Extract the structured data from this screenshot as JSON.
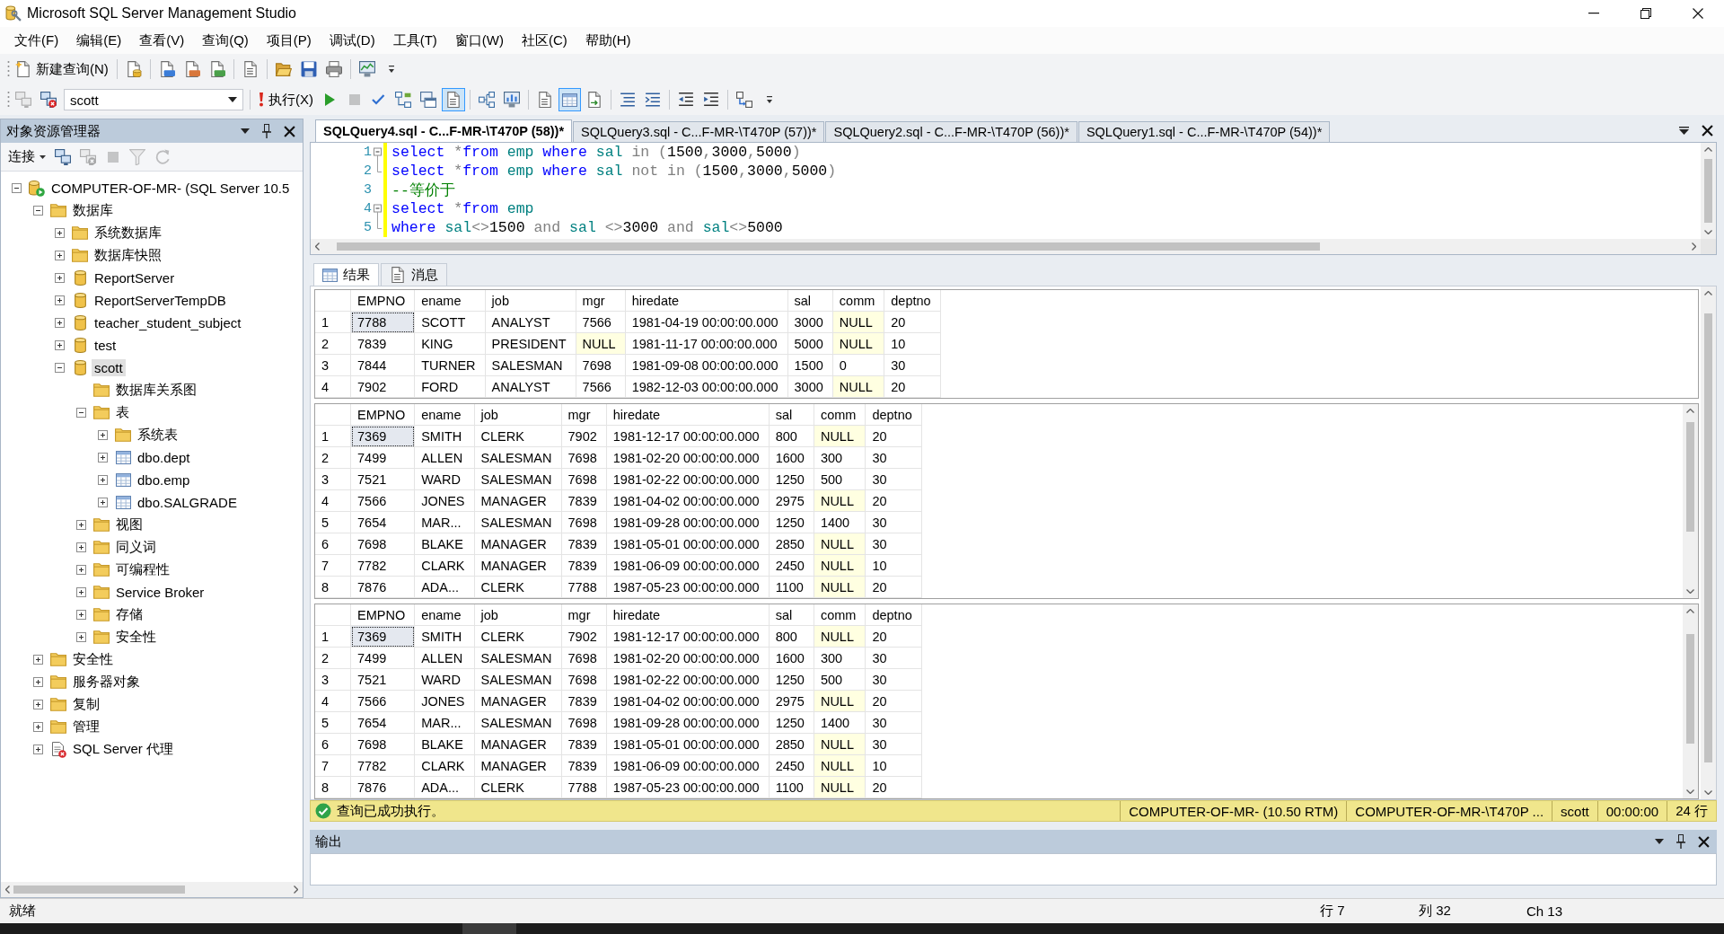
{
  "window": {
    "title": "Microsoft SQL Server Management Studio"
  },
  "menu": [
    "文件(F)",
    "编辑(E)",
    "查看(V)",
    "查询(Q)",
    "项目(P)",
    "调试(D)",
    "工具(T)",
    "窗口(W)",
    "社区(C)",
    "帮助(H)"
  ],
  "toolbar_1": [
    {
      "kind": "new_query",
      "label": "新建查询(N)"
    },
    {
      "kind": "separator"
    },
    {
      "kind": "database_query"
    },
    {
      "kind": "separator"
    },
    {
      "kind": "mdx_query"
    },
    {
      "kind": "dmx_query"
    },
    {
      "kind": "xmla_query"
    },
    {
      "kind": "separator"
    },
    {
      "kind": "compact_query"
    },
    {
      "kind": "separator"
    },
    {
      "kind": "open"
    },
    {
      "kind": "save"
    },
    {
      "kind": "print"
    },
    {
      "kind": "separator"
    },
    {
      "kind": "activity_monitor"
    },
    {
      "kind": "overflow"
    }
  ],
  "toolbar_2": [
    {
      "kind": "connect",
      "disabled": true,
      "pressed": false
    },
    {
      "kind": "change_connection",
      "disabled": false,
      "pressed": false
    },
    {
      "kind": "database",
      "value": "scott"
    },
    {
      "kind": "separator"
    },
    {
      "kind": "execute",
      "label": "执行(X)",
      "disabled": false,
      "pressed": false
    },
    {
      "kind": "debug",
      "disabled": false,
      "pressed": false
    },
    {
      "kind": "cancel",
      "disabled": true,
      "pressed": false
    },
    {
      "kind": "parse",
      "disabled": false,
      "pressed": false
    },
    {
      "kind": "estimated_plan",
      "disabled": false,
      "pressed": false
    },
    {
      "kind": "query_options",
      "disabled": false,
      "pressed": false
    },
    {
      "kind": "intellisense",
      "disabled": false,
      "pressed": true
    },
    {
      "kind": "separator"
    },
    {
      "kind": "include_plan",
      "disabled": false,
      "pressed": false
    },
    {
      "kind": "client_statistics",
      "disabled": false,
      "pressed": false
    },
    {
      "kind": "separator"
    },
    {
      "kind": "results_text",
      "disabled": false,
      "pressed": false
    },
    {
      "kind": "results_grid",
      "disabled": false,
      "pressed": true
    },
    {
      "kind": "results_file",
      "disabled": false,
      "pressed": false
    },
    {
      "kind": "separator"
    },
    {
      "kind": "comment",
      "disabled": false,
      "pressed": false
    },
    {
      "kind": "uncomment",
      "disabled": false,
      "pressed": false
    },
    {
      "kind": "separator"
    },
    {
      "kind": "decrease_indent",
      "disabled": false,
      "pressed": false
    },
    {
      "kind": "increase_indent",
      "disabled": false,
      "pressed": false
    },
    {
      "kind": "separator"
    },
    {
      "kind": "template_values",
      "disabled": false,
      "pressed": false
    },
    {
      "kind": "overflow",
      "disabled": false,
      "pressed": false
    }
  ],
  "object_explorer": {
    "title": "对象资源管理器",
    "toolbar": [
      {
        "kind": "connect_menu",
        "label": "连接",
        "disabled": false
      },
      {
        "kind": "connect",
        "disabled": false
      },
      {
        "kind": "disconnect",
        "disabled": true
      },
      {
        "kind": "stop",
        "disabled": true
      },
      {
        "kind": "filter",
        "disabled": true
      },
      {
        "kind": "refresh",
        "disabled": true
      }
    ],
    "tree": [
      {
        "label": "COMPUTER-OF-MR- (SQL Server 10.5",
        "kind": "server",
        "expanded": true,
        "selected": false,
        "children": [
          {
            "label": "数据库",
            "kind": "folder",
            "expanded": true,
            "selected": false,
            "children": [
              {
                "label": "系统数据库",
                "kind": "folder",
                "expanded": false,
                "selected": false
              },
              {
                "label": "数据库快照",
                "kind": "folder",
                "expanded": false,
                "selected": false
              },
              {
                "label": "ReportServer",
                "kind": "database",
                "expanded": false,
                "selected": false
              },
              {
                "label": "ReportServerTempDB",
                "kind": "database",
                "expanded": false,
                "selected": false
              },
              {
                "label": "teacher_student_subject",
                "kind": "database",
                "expanded": false,
                "selected": false
              },
              {
                "label": "test",
                "kind": "database",
                "expanded": false,
                "selected": false
              },
              {
                "label": "scott",
                "kind": "database",
                "expanded": true,
                "selected": true,
                "children": [
                  {
                    "label": "数据库关系图",
                    "kind": "folder",
                    "selected": false
                  },
                  {
                    "label": "表",
                    "kind": "folder",
                    "expanded": true,
                    "selected": false,
                    "children": [
                      {
                        "label": "系统表",
                        "kind": "folder",
                        "expanded": false,
                        "selected": false
                      },
                      {
                        "label": "dbo.dept",
                        "kind": "table",
                        "expanded": false,
                        "selected": false
                      },
                      {
                        "label": "dbo.emp",
                        "kind": "table",
                        "expanded": false,
                        "selected": false
                      },
                      {
                        "label": "dbo.SALGRADE",
                        "kind": "table",
                        "expanded": false,
                        "selected": false
                      }
                    ]
                  },
                  {
                    "label": "视图",
                    "kind": "folder",
                    "expanded": false,
                    "selected": false
                  },
                  {
                    "label": "同义词",
                    "kind": "folder",
                    "expanded": false,
                    "selected": false
                  },
                  {
                    "label": "可编程性",
                    "kind": "folder",
                    "expanded": false,
                    "selected": false
                  },
                  {
                    "label": "Service Broker",
                    "kind": "folder",
                    "expanded": false,
                    "selected": false
                  },
                  {
                    "label": "存储",
                    "kind": "folder",
                    "expanded": false,
                    "selected": false
                  },
                  {
                    "label": "安全性",
                    "kind": "folder",
                    "expanded": false,
                    "selected": false
                  }
                ]
              }
            ]
          },
          {
            "label": "安全性",
            "kind": "folder",
            "expanded": false,
            "selected": false
          },
          {
            "label": "服务器对象",
            "kind": "folder",
            "expanded": false,
            "selected": false
          },
          {
            "label": "复制",
            "kind": "folder",
            "expanded": false,
            "selected": false
          },
          {
            "label": "管理",
            "kind": "folder",
            "expanded": false,
            "selected": false
          },
          {
            "label": "SQL Server 代理",
            "kind": "agent",
            "expanded": false,
            "selected": false
          }
        ]
      }
    ]
  },
  "documents": {
    "tabs": [
      {
        "label": "SQLQuery4.sql - C...F-MR-\\T470P (58))*",
        "selected": true
      },
      {
        "label": "SQLQuery3.sql - C...F-MR-\\T470P (57))*",
        "selected": false
      },
      {
        "label": "SQLQuery2.sql - C...F-MR-\\T470P (56))*",
        "selected": false
      },
      {
        "label": "SQLQuery1.sql - C...F-MR-\\T470P (54))*",
        "selected": false
      }
    ]
  },
  "editor": {
    "lines": [
      {
        "number": "1",
        "kind": "start",
        "changed": true,
        "tokens": [
          {
            "kind": "keyword",
            "text": "select "
          },
          {
            "kind": "operator",
            "text": "*"
          },
          {
            "kind": "keyword",
            "text": "from "
          },
          {
            "kind": "identifier",
            "text": "emp "
          },
          {
            "kind": "keyword",
            "text": "where "
          },
          {
            "kind": "identifier",
            "text": "sal "
          },
          {
            "kind": "operator",
            "text": "in ("
          },
          {
            "kind": "plain",
            "text": "1500"
          },
          {
            "kind": "operator",
            "text": ","
          },
          {
            "kind": "plain",
            "text": "3000"
          },
          {
            "kind": "operator",
            "text": ","
          },
          {
            "kind": "plain",
            "text": "5000"
          },
          {
            "kind": "operator",
            "text": ")"
          }
        ]
      },
      {
        "number": "2",
        "kind": "end",
        "changed": true,
        "tokens": [
          {
            "kind": "keyword",
            "text": "select "
          },
          {
            "kind": "operator",
            "text": "*"
          },
          {
            "kind": "keyword",
            "text": "from "
          },
          {
            "kind": "identifier",
            "text": "emp "
          },
          {
            "kind": "keyword",
            "text": "where "
          },
          {
            "kind": "identifier",
            "text": "sal "
          },
          {
            "kind": "operator",
            "text": "not in ("
          },
          {
            "kind": "plain",
            "text": "1500"
          },
          {
            "kind": "operator",
            "text": ","
          },
          {
            "kind": "plain",
            "text": "3000"
          },
          {
            "kind": "operator",
            "text": ","
          },
          {
            "kind": "plain",
            "text": "5000"
          },
          {
            "kind": "operator",
            "text": ")"
          }
        ]
      },
      {
        "number": "3",
        "kind": "plain",
        "changed": true,
        "tokens": [
          {
            "kind": "comment",
            "text": "--等价于"
          }
        ]
      },
      {
        "number": "4",
        "kind": "start",
        "changed": true,
        "tokens": [
          {
            "kind": "keyword",
            "text": "select "
          },
          {
            "kind": "operator",
            "text": "*"
          },
          {
            "kind": "keyword",
            "text": "from "
          },
          {
            "kind": "identifier",
            "text": "emp"
          }
        ]
      },
      {
        "number": "5",
        "kind": "end",
        "changed": true,
        "tokens": [
          {
            "kind": "keyword",
            "text": "where "
          },
          {
            "kind": "identifier",
            "text": "sal"
          },
          {
            "kind": "operator",
            "text": "<>"
          },
          {
            "kind": "plain",
            "text": "1500 "
          },
          {
            "kind": "operator",
            "text": "and "
          },
          {
            "kind": "identifier",
            "text": "sal "
          },
          {
            "kind": "operator",
            "text": "<>"
          },
          {
            "kind": "plain",
            "text": "3000 "
          },
          {
            "kind": "operator",
            "text": "and "
          },
          {
            "kind": "identifier",
            "text": "sal"
          },
          {
            "kind": "operator",
            "text": "<>"
          },
          {
            "kind": "plain",
            "text": "5000"
          }
        ]
      }
    ]
  },
  "results": {
    "tabs": [
      {
        "label": "结果",
        "kind": "grid",
        "selected": true
      },
      {
        "label": "消息",
        "kind": "messages",
        "selected": false
      }
    ],
    "grids": [
      {
        "scrollable": false,
        "columns": [
          "EMPNO",
          "ename",
          "job",
          "mgr",
          "hiredate",
          "sal",
          "comm",
          "deptno"
        ],
        "rows": [
          {
            "number": "1",
            "cells": [
              "7788",
              "SCOTT",
              "ANALYST",
              "7566",
              "1981-04-19 00:00:00.000",
              "3000",
              "NULL",
              "20"
            ],
            "nulls": [
              false,
              false,
              false,
              false,
              false,
              false,
              true,
              false
            ],
            "focused": true
          },
          {
            "number": "2",
            "cells": [
              "7839",
              "KING",
              "PRESIDENT",
              "NULL",
              "1981-11-17 00:00:00.000",
              "5000",
              "NULL",
              "10"
            ],
            "nulls": [
              false,
              false,
              false,
              true,
              false,
              false,
              true,
              false
            ],
            "focused": false
          },
          {
            "number": "3",
            "cells": [
              "7844",
              "TURNER",
              "SALESMAN",
              "7698",
              "1981-09-08 00:00:00.000",
              "1500",
              "0",
              "30"
            ],
            "nulls": [
              false,
              false,
              false,
              false,
              false,
              false,
              false,
              false
            ],
            "focused": false
          },
          {
            "number": "4",
            "cells": [
              "7902",
              "FORD",
              "ANALYST",
              "7566",
              "1982-12-03 00:00:00.000",
              "3000",
              "NULL",
              "20"
            ],
            "nulls": [
              false,
              false,
              false,
              false,
              false,
              false,
              true,
              false
            ],
            "focused": false
          }
        ]
      },
      {
        "scrollable": true,
        "columns": [
          "EMPNO",
          "ename",
          "job",
          "mgr",
          "hiredate",
          "sal",
          "comm",
          "deptno"
        ],
        "rows": [
          {
            "number": "1",
            "cells": [
              "7369",
              "SMITH",
              "CLERK",
              "7902",
              "1981-12-17 00:00:00.000",
              "800",
              "NULL",
              "20"
            ],
            "nulls": [
              false,
              false,
              false,
              false,
              false,
              false,
              true,
              false
            ],
            "focused": true
          },
          {
            "number": "2",
            "cells": [
              "7499",
              "ALLEN",
              "SALESMAN",
              "7698",
              "1981-02-20 00:00:00.000",
              "1600",
              "300",
              "30"
            ],
            "nulls": [
              false,
              false,
              false,
              false,
              false,
              false,
              false,
              false
            ],
            "focused": false
          },
          {
            "number": "3",
            "cells": [
              "7521",
              "WARD",
              "SALESMAN",
              "7698",
              "1981-02-22 00:00:00.000",
              "1250",
              "500",
              "30"
            ],
            "nulls": [
              false,
              false,
              false,
              false,
              false,
              false,
              false,
              false
            ],
            "focused": false
          },
          {
            "number": "4",
            "cells": [
              "7566",
              "JONES",
              "MANAGER",
              "7839",
              "1981-04-02 00:00:00.000",
              "2975",
              "NULL",
              "20"
            ],
            "nulls": [
              false,
              false,
              false,
              false,
              false,
              false,
              true,
              false
            ],
            "focused": false
          },
          {
            "number": "5",
            "cells": [
              "7654",
              "MAR...",
              "SALESMAN",
              "7698",
              "1981-09-28 00:00:00.000",
              "1250",
              "1400",
              "30"
            ],
            "nulls": [
              false,
              false,
              false,
              false,
              false,
              false,
              false,
              false
            ],
            "focused": false
          },
          {
            "number": "6",
            "cells": [
              "7698",
              "BLAKE",
              "MANAGER",
              "7839",
              "1981-05-01 00:00:00.000",
              "2850",
              "NULL",
              "30"
            ],
            "nulls": [
              false,
              false,
              false,
              false,
              false,
              false,
              true,
              false
            ],
            "focused": false
          },
          {
            "number": "7",
            "cells": [
              "7782",
              "CLARK",
              "MANAGER",
              "7839",
              "1981-06-09 00:00:00.000",
              "2450",
              "NULL",
              "10"
            ],
            "nulls": [
              false,
              false,
              false,
              false,
              false,
              false,
              true,
              false
            ],
            "focused": false
          },
          {
            "number": "8",
            "cells": [
              "7876",
              "ADA...",
              "CLERK",
              "7788",
              "1987-05-23 00:00:00.000",
              "1100",
              "NULL",
              "20"
            ],
            "nulls": [
              false,
              false,
              false,
              false,
              false,
              false,
              true,
              false
            ],
            "focused": false
          }
        ]
      },
      {
        "scrollable": true,
        "columns": [
          "EMPNO",
          "ename",
          "job",
          "mgr",
          "hiredate",
          "sal",
          "comm",
          "deptno"
        ],
        "rows": [
          {
            "number": "1",
            "cells": [
              "7369",
              "SMITH",
              "CLERK",
              "7902",
              "1981-12-17 00:00:00.000",
              "800",
              "NULL",
              "20"
            ],
            "nulls": [
              false,
              false,
              false,
              false,
              false,
              false,
              true,
              false
            ],
            "focused": true
          },
          {
            "number": "2",
            "cells": [
              "7499",
              "ALLEN",
              "SALESMAN",
              "7698",
              "1981-02-20 00:00:00.000",
              "1600",
              "300",
              "30"
            ],
            "nulls": [
              false,
              false,
              false,
              false,
              false,
              false,
              false,
              false
            ],
            "focused": false
          },
          {
            "number": "3",
            "cells": [
              "7521",
              "WARD",
              "SALESMAN",
              "7698",
              "1981-02-22 00:00:00.000",
              "1250",
              "500",
              "30"
            ],
            "nulls": [
              false,
              false,
              false,
              false,
              false,
              false,
              false,
              false
            ],
            "focused": false
          },
          {
            "number": "4",
            "cells": [
              "7566",
              "JONES",
              "MANAGER",
              "7839",
              "1981-04-02 00:00:00.000",
              "2975",
              "NULL",
              "20"
            ],
            "nulls": [
              false,
              false,
              false,
              false,
              false,
              false,
              true,
              false
            ],
            "focused": false
          },
          {
            "number": "5",
            "cells": [
              "7654",
              "MAR...",
              "SALESMAN",
              "7698",
              "1981-09-28 00:00:00.000",
              "1250",
              "1400",
              "30"
            ],
            "nulls": [
              false,
              false,
              false,
              false,
              false,
              false,
              false,
              false
            ],
            "focused": false
          },
          {
            "number": "6",
            "cells": [
              "7698",
              "BLAKE",
              "MANAGER",
              "7839",
              "1981-05-01 00:00:00.000",
              "2850",
              "NULL",
              "30"
            ],
            "nulls": [
              false,
              false,
              false,
              false,
              false,
              false,
              true,
              false
            ],
            "focused": false
          },
          {
            "number": "7",
            "cells": [
              "7782",
              "CLARK",
              "MANAGER",
              "7839",
              "1981-06-09 00:00:00.000",
              "2450",
              "NULL",
              "10"
            ],
            "nulls": [
              false,
              false,
              false,
              false,
              false,
              false,
              true,
              false
            ],
            "focused": false
          },
          {
            "number": "8",
            "cells": [
              "7876",
              "ADA...",
              "CLERK",
              "7788",
              "1987-05-23 00:00:00.000",
              "1100",
              "NULL",
              "20"
            ],
            "nulls": [
              false,
              false,
              false,
              false,
              false,
              false,
              true,
              false
            ],
            "focused": false
          }
        ]
      }
    ]
  },
  "query_status": {
    "message": "查询已成功执行。",
    "sections": [
      "COMPUTER-OF-MR- (10.50 RTM)",
      "COMPUTER-OF-MR-\\T470P ...",
      "scott",
      "00:00:00",
      "24 行"
    ]
  },
  "output": {
    "title": "输出"
  },
  "status_bar": {
    "text": "就绪",
    "line": "行 7",
    "column": "列 32",
    "char": "Ch 13"
  }
}
